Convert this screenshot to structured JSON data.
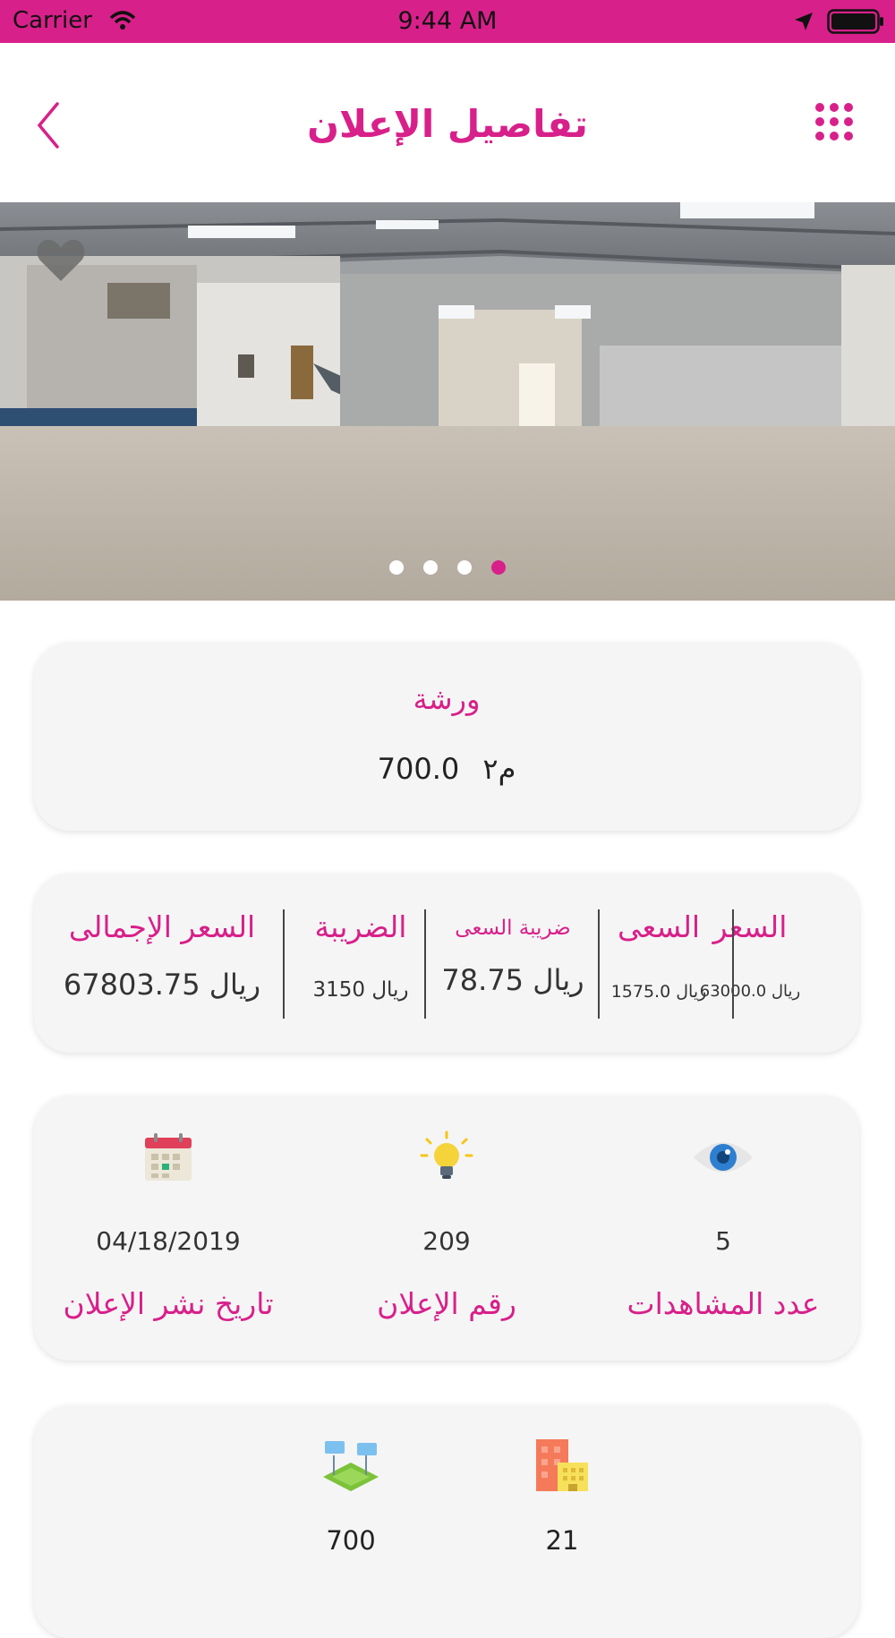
{
  "status_bar": {
    "carrier": "Carrier",
    "time": "9:44 AM"
  },
  "header": {
    "title": "تفاصيل الإعلان"
  },
  "gallery": {
    "total_images": 4,
    "active_index": 4
  },
  "summary": {
    "property_type": "ورشة",
    "area_value": "700.0",
    "area_unit": "م٢"
  },
  "pricing": {
    "price_label": "السعر",
    "price_value": "63000.0 ريال",
    "commission_label": "السعى",
    "commission_value": "1575.0 ريال",
    "commission_tax_label": "ضريبة السعى",
    "commission_tax_value": "78.75 ريال",
    "tax_label": "الضريبة",
    "tax_value": "3150 ريال",
    "total_label": "السعر الإجمالى",
    "total_value": "67803.75 ريال"
  },
  "stats": {
    "views_label": "عدد المشاهدات",
    "views_value": "5",
    "ad_number_label": "رقم الإعلان",
    "ad_number_value": "209",
    "publish_date_label": "تاريخ نشر الإعلان",
    "publish_date_value": "04/18/2019"
  },
  "features": {
    "buildings_value": "21",
    "land_value": "700"
  },
  "colors": {
    "brand": "#d8208a",
    "card_bg": "#f5f5f5"
  },
  "icons": [
    "chevron-left-icon",
    "grid-menu-icon",
    "heart-icon",
    "eye-icon",
    "lightbulb-icon",
    "calendar-icon",
    "buildings-icon",
    "land-icon"
  ]
}
